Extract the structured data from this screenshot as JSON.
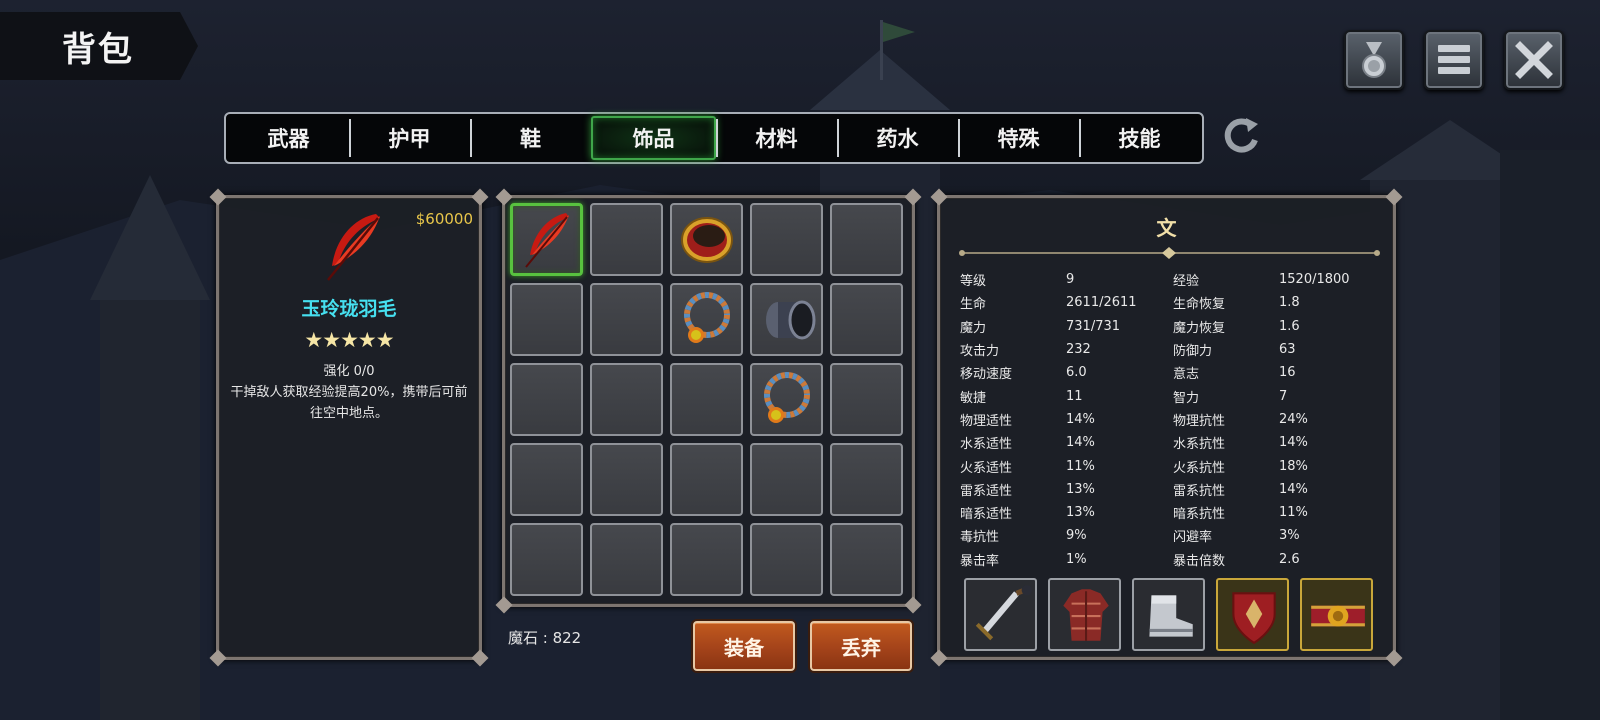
{
  "screen_title": "背包",
  "top_buttons": [
    {
      "icon": "medal-icon"
    },
    {
      "icon": "menu-icon"
    },
    {
      "icon": "close-icon"
    }
  ],
  "tabs": [
    {
      "label": "武器",
      "active": false
    },
    {
      "label": "护甲",
      "active": false
    },
    {
      "label": "鞋",
      "active": false
    },
    {
      "label": "饰品",
      "active": true
    },
    {
      "label": "材料",
      "active": false
    },
    {
      "label": "药水",
      "active": false
    },
    {
      "label": "特殊",
      "active": false
    },
    {
      "label": "技能",
      "active": false
    }
  ],
  "refresh_icon": "refresh-icon",
  "selected_item": {
    "icon": "red-feather-icon",
    "price": "$60000",
    "name": "玉玲珑羽毛",
    "stars": "★★★★★",
    "enhance": "强化 0/0",
    "description": "干掉敌人获取经验提高20%，携带后可前往空中地点。"
  },
  "inventory": [
    "red-feather-icon",
    "",
    "gold-ring-icon",
    "",
    "",
    "",
    "",
    "beaded-necklace-icon",
    "dark-bracer-icon",
    "",
    "",
    "",
    "",
    "beaded-necklace-icon",
    "",
    "",
    "",
    "",
    "",
    "",
    "",
    "",
    "",
    "",
    ""
  ],
  "currency": "魔石 : 822",
  "actions": {
    "equip": "装备",
    "discard": "丢弃"
  },
  "character": {
    "name": "文",
    "stats": [
      [
        "等级",
        "9",
        "经验",
        "1520/1800"
      ],
      [
        "生命",
        "2611/2611",
        "生命恢复",
        "1.8"
      ],
      [
        "魔力",
        "731/731",
        "魔力恢复",
        "1.6"
      ],
      [
        "攻击力",
        "232",
        "防御力",
        "63"
      ],
      [
        "移动速度",
        "6.0",
        "意志",
        "16"
      ],
      [
        "敏捷",
        "11",
        "智力",
        "7"
      ],
      [
        "物理适性",
        "14%",
        "物理抗性",
        "24%"
      ],
      [
        "水系适性",
        "14%",
        "水系抗性",
        "14%"
      ],
      [
        "火系适性",
        "11%",
        "火系抗性",
        "18%"
      ],
      [
        "雷系适性",
        "13%",
        "雷系抗性",
        "14%"
      ],
      [
        "暗系适性",
        "13%",
        "暗系抗性",
        "11%"
      ],
      [
        "毒抗性",
        "9%",
        "闪避率",
        "3%"
      ],
      [
        "暴击率",
        "1%",
        "暴击倍数",
        "2.6"
      ]
    ],
    "equipment": [
      {
        "icon": "sword-icon",
        "rare": false
      },
      {
        "icon": "leather-armor-icon",
        "rare": false
      },
      {
        "icon": "steel-boots-icon",
        "rare": false
      },
      {
        "icon": "shield-icon",
        "rare": true
      },
      {
        "icon": "belt-icon",
        "rare": true
      }
    ]
  }
}
